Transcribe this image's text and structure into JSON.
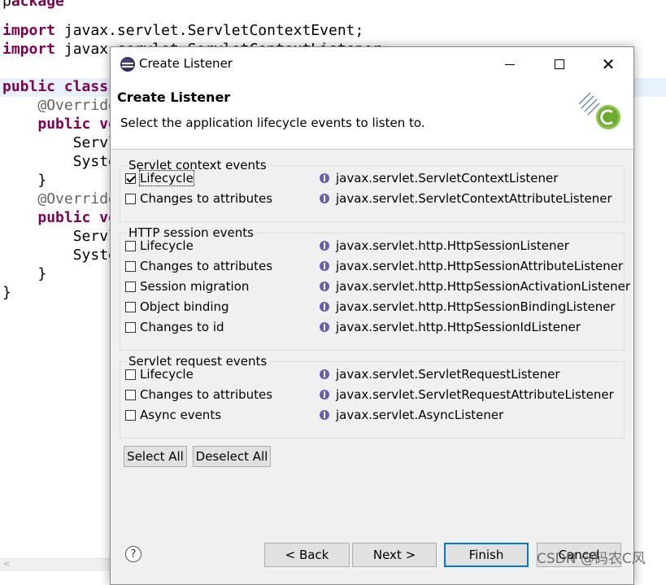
{
  "editor": {
    "lines": [
      {
        "parts": [
          {
            "t": "p",
            "k": "plain"
          },
          {
            "t": "ackage",
            "k": "kw"
          }
        ]
      },
      {
        "parts": [
          {
            "t": "import",
            "k": "kw"
          },
          {
            "t": " javax.servlet.ServletContextEvent;",
            "k": "plain"
          }
        ]
      },
      {
        "parts": [
          {
            "t": "import",
            "k": "kw"
          },
          {
            "t": " javax.servlet.ServletContextListener;",
            "k": "plain"
          }
        ]
      },
      {
        "parts": [
          {
            "t": "",
            "k": "plain"
          }
        ]
      },
      {
        "parts": [
          {
            "t": "public",
            "k": "kw"
          },
          {
            "t": " ",
            "k": "plain"
          },
          {
            "t": "class",
            "k": "kw"
          }
        ]
      },
      {
        "parts": [
          {
            "t": "    ",
            "k": "plain"
          },
          {
            "t": "@Override",
            "k": "ann"
          }
        ]
      },
      {
        "parts": [
          {
            "t": "    ",
            "k": "plain"
          },
          {
            "t": "public",
            "k": "kw"
          },
          {
            "t": " ",
            "k": "plain"
          },
          {
            "t": "void",
            "k": "kw"
          }
        ]
      },
      {
        "parts": [
          {
            "t": "        ServletContext",
            "k": "plain"
          }
        ]
      },
      {
        "parts": [
          {
            "t": "        System",
            "k": "plain"
          }
        ]
      },
      {
        "parts": [
          {
            "t": "    }",
            "k": "plain"
          }
        ]
      },
      {
        "parts": [
          {
            "t": "    ",
            "k": "plain"
          },
          {
            "t": "@Override",
            "k": "ann"
          }
        ]
      },
      {
        "parts": [
          {
            "t": "    ",
            "k": "plain"
          },
          {
            "t": "public",
            "k": "kw"
          },
          {
            "t": " ",
            "k": "plain"
          },
          {
            "t": "void",
            "k": "kw"
          }
        ]
      },
      {
        "parts": [
          {
            "t": "        ServletContext",
            "k": "plain"
          }
        ]
      },
      {
        "parts": [
          {
            "t": "        System",
            "k": "plain"
          }
        ]
      },
      {
        "parts": [
          {
            "t": "    }",
            "k": "plain"
          }
        ]
      },
      {
        "parts": [
          {
            "t": "}",
            "k": "plain"
          }
        ]
      }
    ]
  },
  "window": {
    "title": "Create Listener",
    "close_glyph": "✕"
  },
  "header": {
    "title": "Create Listener",
    "description": "Select the application lifecycle events to listen to."
  },
  "groups": [
    {
      "label": "Servlet context events",
      "items": [
        {
          "label": "Lifecycle",
          "checked": true,
          "interface": "javax.servlet.ServletContextListener"
        },
        {
          "label": "Changes to attributes",
          "checked": false,
          "interface": "javax.servlet.ServletContextAttributeListener"
        }
      ]
    },
    {
      "label": "HTTP session events",
      "items": [
        {
          "label": "Lifecycle",
          "checked": false,
          "interface": "javax.servlet.http.HttpSessionListener"
        },
        {
          "label": "Changes to attributes",
          "checked": false,
          "interface": "javax.servlet.http.HttpSessionAttributeListener"
        },
        {
          "label": "Session migration",
          "checked": false,
          "interface": "javax.servlet.http.HttpSessionActivationListener"
        },
        {
          "label": "Object binding",
          "checked": false,
          "interface": "javax.servlet.http.HttpSessionBindingListener"
        },
        {
          "label": "Changes to id",
          "checked": false,
          "interface": "javax.servlet.http.HttpSessionIdListener"
        }
      ]
    },
    {
      "label": "Servlet request events",
      "items": [
        {
          "label": "Lifecycle",
          "checked": false,
          "interface": "javax.servlet.ServletRequestListener"
        },
        {
          "label": "Changes to attributes",
          "checked": false,
          "interface": "javax.servlet.ServletRequestAttributeListener"
        },
        {
          "label": "Async events",
          "checked": false,
          "interface": "javax.servlet.AsyncListener"
        }
      ]
    }
  ],
  "selection_buttons": {
    "select_all": "Select All",
    "deselect_all": "Deselect All"
  },
  "footer": {
    "help": "?",
    "back": "< Back",
    "next": "Next >",
    "finish": "Finish",
    "cancel": "Cancel"
  },
  "watermark": "CSDN @码农C风",
  "colors": {
    "keyword": "#7f0055",
    "annotation": "#646464",
    "dialog_bg": "#f0f0f0",
    "default_button_border": "#0078d7",
    "interface_icon": "#6b5bb2"
  }
}
